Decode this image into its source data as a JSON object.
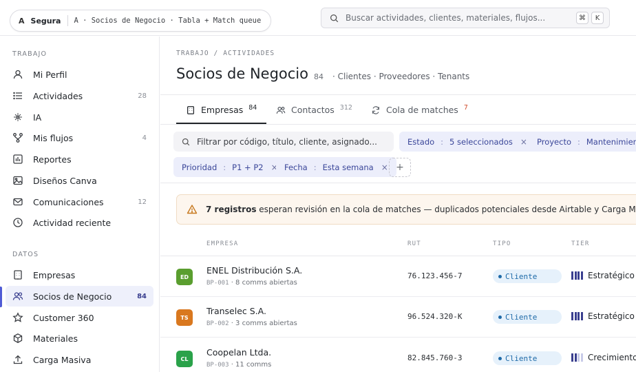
{
  "topbar": {
    "workspace_letter": "A",
    "workspace_name": "Segura",
    "workspace_path": "A · Socios de Negocio · Tabla + Match queue",
    "search_placeholder": "Buscar actividades, clientes, materiales, flujos...",
    "shortcut_keys": [
      "⌘",
      "K"
    ]
  },
  "sidebar": {
    "sections": [
      {
        "title": "TRABAJO",
        "items": [
          {
            "label": "Mi Perfil",
            "count": "",
            "icon": "user-icon"
          },
          {
            "label": "Actividades",
            "count": "28",
            "icon": "list-icon"
          },
          {
            "label": "IA",
            "count": "",
            "icon": "sparkle-icon"
          },
          {
            "label": "Mis flujos",
            "count": "4",
            "icon": "flow-icon"
          },
          {
            "label": "Reportes",
            "count": "",
            "icon": "chart-icon"
          },
          {
            "label": "Diseños Canva",
            "count": "",
            "icon": "image-icon"
          },
          {
            "label": "Comunicaciones",
            "count": "12",
            "icon": "mail-icon"
          },
          {
            "label": "Actividad reciente",
            "count": "",
            "icon": "clock-icon"
          }
        ]
      },
      {
        "title": "DATOS",
        "items": [
          {
            "label": "Empresas",
            "count": "",
            "icon": "building-icon"
          },
          {
            "label": "Socios de Negocio",
            "count": "84",
            "icon": "users-icon",
            "active": true
          },
          {
            "label": "Customer 360",
            "count": "",
            "icon": "star-icon"
          },
          {
            "label": "Materiales",
            "count": "",
            "icon": "box-icon"
          },
          {
            "label": "Carga Masiva",
            "count": "",
            "icon": "upload-icon"
          }
        ]
      }
    ]
  },
  "main": {
    "breadcrumb": "TRABAJO / ACTIVIDADES",
    "title": "Socios de Negocio",
    "title_count": "84",
    "title_sub": "· Clientes · Proveedores · Tenants",
    "tabs": [
      {
        "label": "Empresas",
        "count": "84",
        "icon": "building-icon",
        "active": true
      },
      {
        "label": "Contactos",
        "count": "312",
        "icon": "users-icon"
      },
      {
        "label": "Cola de matches",
        "count": "7",
        "icon": "refresh-icon",
        "count_color": "#d14b2a"
      }
    ],
    "filter_placeholder": "Filtrar por código, título, cliente, asignado...",
    "chips": [
      {
        "key": "Estado",
        "value": "5 seleccionados"
      },
      {
        "key": "Proyecto",
        "value": "Mantenimiento"
      },
      {
        "key": "Prioridad",
        "value": "P1 + P2"
      },
      {
        "key": "Fecha",
        "value": "Esta semana"
      }
    ],
    "add_chip_label": "+",
    "alert": {
      "bold": "7 registros",
      "text": " esperan revisión en la cola de matches — duplicados potenciales desde Airtable y Carga Masiva.",
      "accent": "#c77a20"
    },
    "table": {
      "columns": [
        "EMPRESA",
        "RUT",
        "TIPO",
        "TIER"
      ],
      "rows": [
        {
          "initials": "ED",
          "avatar_color": "#5a9e2f",
          "name": "ENEL Distribución S.A.",
          "code": "BP-001",
          "meta": "· 8 comms abiertas",
          "rut": "76.123.456-7",
          "tipo": "Cliente",
          "tier": "Estratégico",
          "tier_level": 4
        },
        {
          "initials": "TS",
          "avatar_color": "#d9781f",
          "name": "Transelec S.A.",
          "code": "BP-002",
          "meta": "· 3 comms abiertas",
          "rut": "96.524.320-K",
          "tipo": "Cliente",
          "tier": "Estratégico",
          "tier_level": 4
        },
        {
          "initials": "CL",
          "avatar_color": "#2aa24a",
          "name": "Coopelan Ltda.",
          "code": "BP-003",
          "meta": "· 11 comms",
          "rut": "82.845.760-3",
          "tipo": "Cliente",
          "tier": "Crecimiento",
          "tier_level": 2
        }
      ]
    }
  }
}
